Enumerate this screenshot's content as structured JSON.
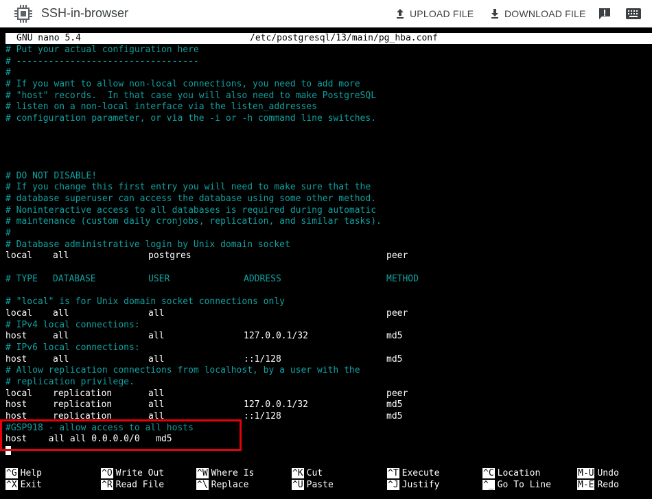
{
  "app": {
    "title": "SSH-in-browser",
    "upload_label": "UPLOAD FILE",
    "download_label": "DOWNLOAD FILE"
  },
  "nano": {
    "version": "GNU nano 5.4",
    "filename": "/etc/postgresql/13/main/pg_hba.conf"
  },
  "lines": [
    {
      "type": "comment",
      "text": "# Put your actual configuration here"
    },
    {
      "type": "comment",
      "text": "# ----------------------------------"
    },
    {
      "type": "comment",
      "text": "#"
    },
    {
      "type": "comment",
      "text": "# If you want to allow non-local connections, you need to add more"
    },
    {
      "type": "comment",
      "text": "# \"host\" records.  In that case you will also need to make PostgreSQL"
    },
    {
      "type": "comment",
      "text": "# listen on a non-local interface via the listen_addresses"
    },
    {
      "type": "comment",
      "text": "# configuration parameter, or via the -i or -h command line switches."
    },
    {
      "type": "blank",
      "text": ""
    },
    {
      "type": "blank",
      "text": ""
    },
    {
      "type": "blank",
      "text": ""
    },
    {
      "type": "blank",
      "text": ""
    },
    {
      "type": "comment",
      "text": "# DO NOT DISABLE!"
    },
    {
      "type": "comment",
      "text": "# If you change this first entry you will need to make sure that the"
    },
    {
      "type": "comment",
      "text": "# database superuser can access the database using some other method."
    },
    {
      "type": "comment",
      "text": "# Noninteractive access to all databases is required during automatic"
    },
    {
      "type": "comment",
      "text": "# maintenance (custom daily cronjobs, replication, and similar tasks)."
    },
    {
      "type": "comment",
      "text": "#"
    },
    {
      "type": "comment",
      "text": "# Database administrative login by Unix domain socket"
    },
    {
      "type": "row",
      "cols": [
        "local",
        "all",
        "postgres",
        "",
        "peer"
      ]
    },
    {
      "type": "blank",
      "text": ""
    },
    {
      "type": "commentrow",
      "cols": [
        "# TYPE",
        "DATABASE",
        "USER",
        "ADDRESS",
        "METHOD"
      ]
    },
    {
      "type": "blank",
      "text": ""
    },
    {
      "type": "comment",
      "text": "# \"local\" is for Unix domain socket connections only"
    },
    {
      "type": "row",
      "cols": [
        "local",
        "all",
        "all",
        "",
        "peer"
      ]
    },
    {
      "type": "comment",
      "text": "# IPv4 local connections:"
    },
    {
      "type": "row",
      "cols": [
        "host",
        "all",
        "all",
        "127.0.0.1/32",
        "md5"
      ]
    },
    {
      "type": "comment",
      "text": "# IPv6 local connections:"
    },
    {
      "type": "row",
      "cols": [
        "host",
        "all",
        "all",
        "::1/128",
        "md5"
      ]
    },
    {
      "type": "comment",
      "text": "# Allow replication connections from localhost, by a user with the"
    },
    {
      "type": "comment",
      "text": "# replication privilege."
    },
    {
      "type": "row",
      "cols": [
        "local",
        "replication",
        "all",
        "",
        "peer"
      ]
    },
    {
      "type": "row",
      "cols": [
        "host",
        "replication",
        "all",
        "127.0.0.1/32",
        "md5"
      ]
    },
    {
      "type": "row",
      "cols": [
        "host",
        "replication",
        "all",
        "::1/128",
        "md5"
      ]
    },
    {
      "type": "comment",
      "text": "#GSP918 - allow access to all hosts"
    },
    {
      "type": "plain",
      "text": "host    all all 0.0.0.0/0   md5"
    },
    {
      "type": "cursor",
      "text": ""
    }
  ],
  "shortcuts": [
    {
      "key": "^G",
      "label": "Help"
    },
    {
      "key": "^X",
      "label": "Exit"
    },
    {
      "key": "^O",
      "label": "Write Out"
    },
    {
      "key": "^R",
      "label": "Read File"
    },
    {
      "key": "^W",
      "label": "Where Is"
    },
    {
      "key": "^\\",
      "label": "Replace"
    },
    {
      "key": "^K",
      "label": "Cut"
    },
    {
      "key": "^U",
      "label": "Paste"
    },
    {
      "key": "^T",
      "label": "Execute"
    },
    {
      "key": "^J",
      "label": "Justify"
    },
    {
      "key": "^C",
      "label": "Location"
    },
    {
      "key": "^_",
      "label": "Go To Line"
    },
    {
      "key": "M-U",
      "label": "Undo"
    },
    {
      "key": "M-E",
      "label": "Redo"
    }
  ],
  "colors": {
    "comment": "#10a0a0",
    "highlight_border": "#e8000b",
    "terminal_bg": "#000000"
  }
}
